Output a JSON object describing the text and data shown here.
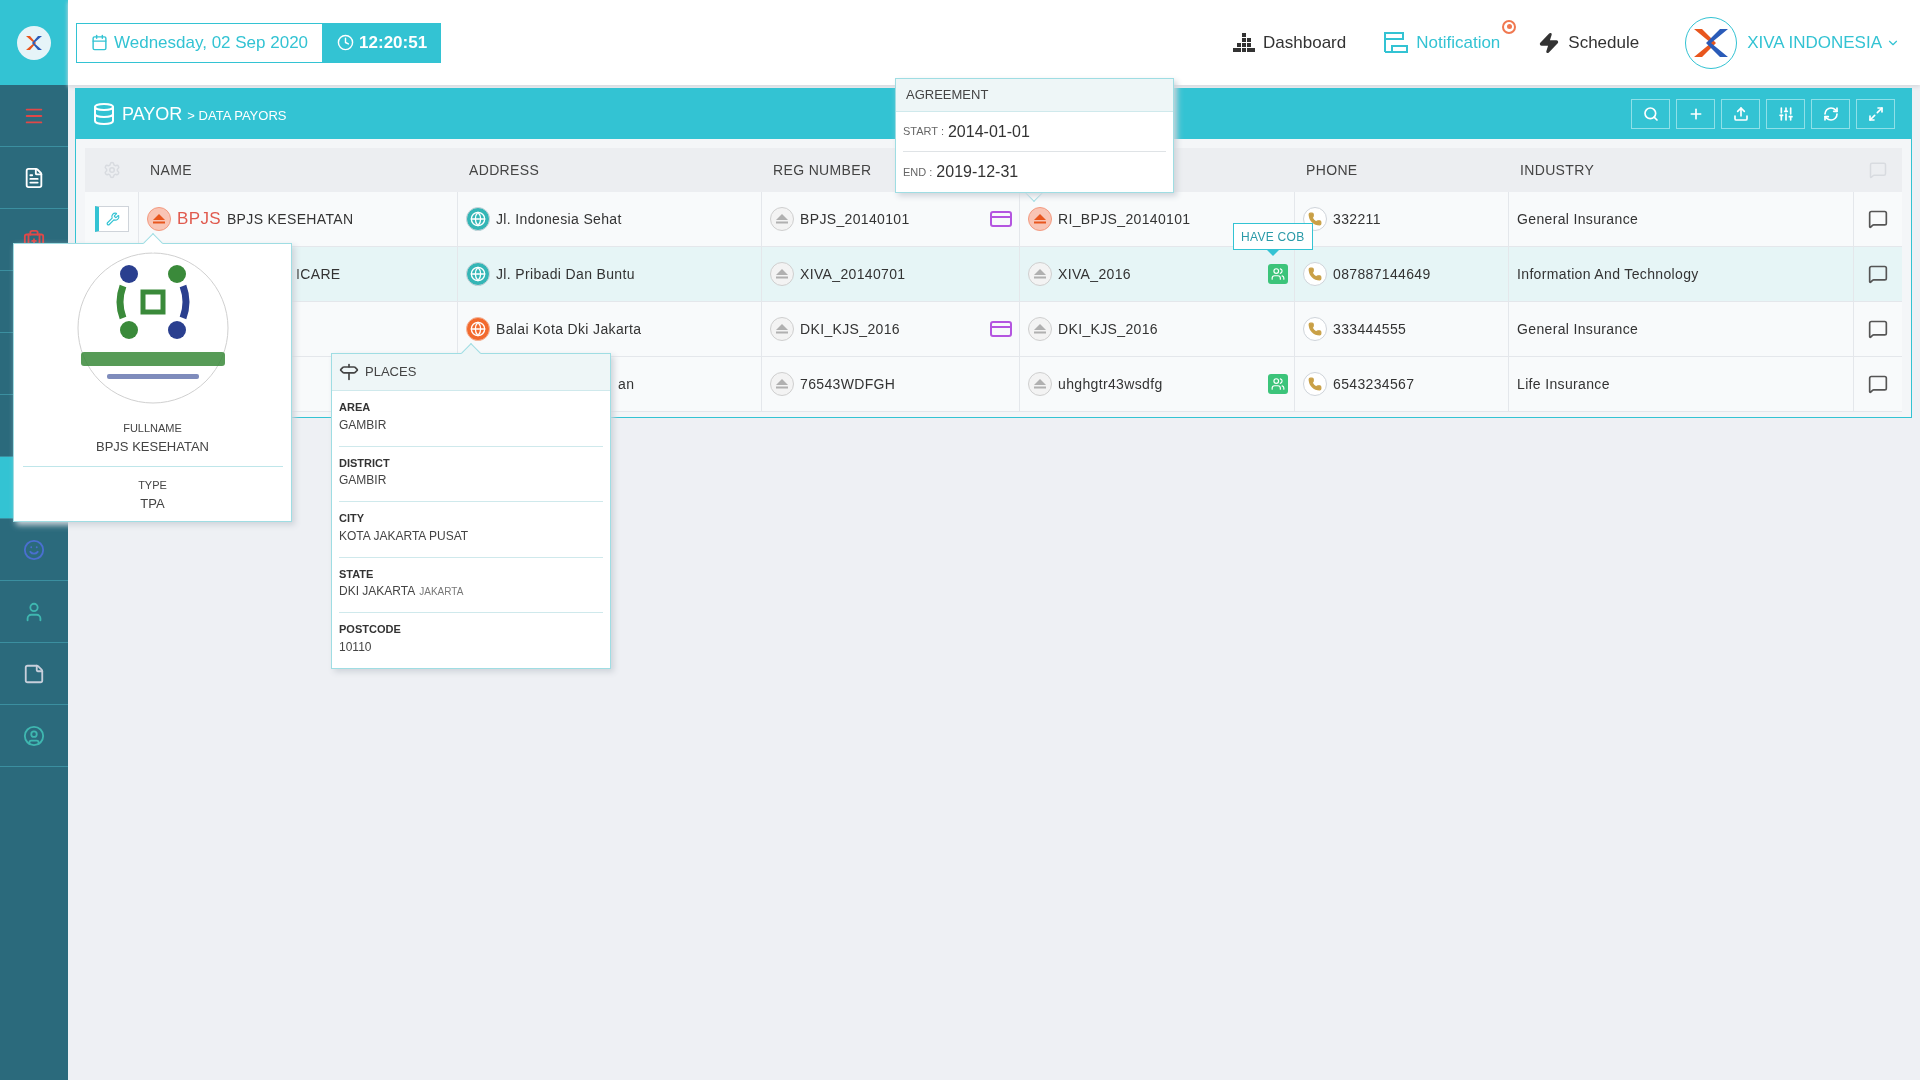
{
  "topbar": {
    "date": "Wednesday, 02 Sep 2020",
    "time": "12:20:51",
    "nav": [
      {
        "label": "Dashboard",
        "selected": false
      },
      {
        "label": "Notification",
        "selected": true
      },
      {
        "label": "Schedule",
        "selected": false
      }
    ],
    "company": "XIVA INDONESIA"
  },
  "sidebar": {
    "items": [
      {
        "selected": false
      },
      {
        "selected": false
      },
      {
        "selected": false
      },
      {
        "selected": false
      },
      {
        "selected": false
      },
      {
        "selected": false
      },
      {
        "selected": true
      },
      {
        "selected": false
      },
      {
        "selected": false
      },
      {
        "selected": false
      },
      {
        "selected": false
      }
    ]
  },
  "panel": {
    "title": "PAYOR",
    "subtitle": "> DATA PAYORS"
  },
  "table": {
    "columns": {
      "name": "NAME",
      "address": "ADDRESS",
      "reg_number": "REG NUMBER",
      "phone": "PHONE",
      "industry": "INDUSTRY"
    },
    "rows": [
      {
        "selected": false,
        "action": true,
        "name_marker": true,
        "name_prefix": "BPJS",
        "name": "BPJS KESEHATAN",
        "address_active": false,
        "address": "Jl. Indonesia Sehat",
        "reg_number": "BPJS_20140101",
        "card": true,
        "column_4_active": true,
        "column_4": "RI_BPJS_20140101",
        "cob": false,
        "phone": "332211",
        "industry": "General Insurance"
      },
      {
        "selected": true,
        "name": "ICARE",
        "address_active": false,
        "address": "Jl. Pribadi Dan Buntu",
        "reg_number": "XIVA_20140701",
        "card": false,
        "column_4_active": false,
        "column_4": "XIVA_2016",
        "cob": true,
        "phone": "087887144649",
        "industry": "Information And Technology"
      },
      {
        "selected": false,
        "address_active": true,
        "address": "Balai Kota Dki Jakarta",
        "reg_number": "DKI_KJS_2016",
        "card": true,
        "column_4_active": false,
        "column_4": "DKI_KJS_2016",
        "cob": false,
        "phone": "333444555",
        "industry": "General Insurance"
      },
      {
        "selected": false,
        "address": "an",
        "reg_number": "76543WDFGH",
        "card": false,
        "column_4_active": false,
        "column_4": "uhghgtr43wsdfg",
        "cob": true,
        "phone": "6543234567",
        "industry": "Life Insurance"
      }
    ]
  },
  "payor_card": {
    "fullname_label": "FULLNAME",
    "fullname": "BPJS KESEHATAN",
    "type_label": "TYPE",
    "type": "TPA"
  },
  "places_popup": {
    "title": "PLACES",
    "fields": [
      {
        "label": "AREA",
        "value": "GAMBIR"
      },
      {
        "label": "DISTRICT",
        "value": "GAMBIR"
      },
      {
        "label": "CITY",
        "value": "KOTA JAKARTA PUSAT"
      },
      {
        "label": "STATE",
        "value": "DKI JAKARTA",
        "note": "JAKARTA"
      },
      {
        "label": "POSTCODE",
        "value": "10110"
      }
    ]
  },
  "agreement_popup": {
    "title": "AGREEMENT",
    "start_label": "START :",
    "start": "2014-01-01",
    "end_label": "END :",
    "end": "2019-12-31"
  },
  "tooltip": "HAVE COB"
}
